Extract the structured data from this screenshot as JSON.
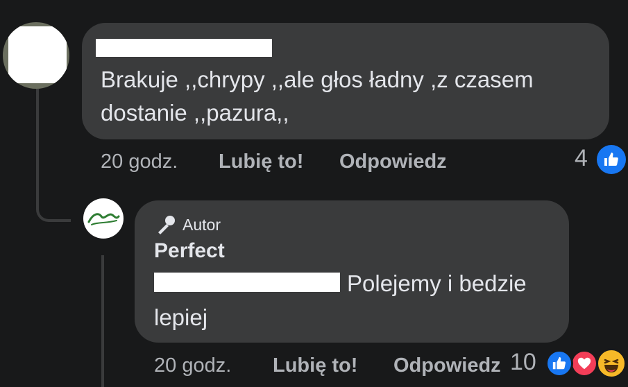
{
  "comment": {
    "text_line1": "Brakuje ,,chrypy ,,ale głos ładny ,z czasem",
    "text_line2": "dostanie ,,pazura,,",
    "time": "20 godz.",
    "like_label": "Lubię to!",
    "reply_label": "Odpowiedz",
    "reaction_count": "4"
  },
  "reply": {
    "badge": "Autor",
    "author": "Perfect",
    "text_line1": "Polejemy i bedzie",
    "text_line2": "lepiej",
    "time": "20 godz.",
    "like_label": "Lubię to!",
    "reply_label": "Odpowiedz",
    "reaction_count": "10"
  },
  "colors": {
    "background": "#18191a",
    "bubble": "#3a3b3c",
    "text": "#e4e6eb",
    "secondary": "#b0b3b8",
    "like_blue": "#1877f2",
    "love_red": "#f33e58",
    "haha_yellow": "#f7b928"
  },
  "icons": [
    "like-icon",
    "love-icon",
    "haha-icon",
    "microphone-icon"
  ]
}
